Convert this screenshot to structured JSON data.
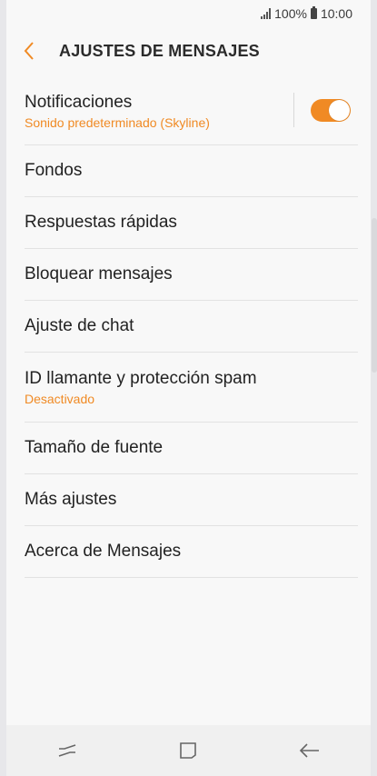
{
  "status": {
    "battery": "100%",
    "time": "10:00"
  },
  "header": {
    "title": "AJUSTES DE MENSAJES"
  },
  "items": [
    {
      "label": "Notificaciones",
      "sub": "Sonido predeterminado (Skyline)",
      "toggle": true
    },
    {
      "label": "Fondos"
    },
    {
      "label": "Respuestas rápidas"
    },
    {
      "label": "Bloquear mensajes"
    },
    {
      "label": "Ajuste de chat"
    },
    {
      "label": "ID llamante y protección spam",
      "sub": "Desactivado"
    },
    {
      "label": "Tamaño de fuente"
    },
    {
      "label": "Más ajustes"
    },
    {
      "label": "Acerca de Mensajes"
    }
  ],
  "colors": {
    "accent": "#f08a24",
    "background": "#f8f8f8"
  },
  "icons": {
    "back": "chevron-left-icon",
    "recents": "recents-icon",
    "home": "home-icon",
    "nav_back": "back-arrow-icon"
  }
}
